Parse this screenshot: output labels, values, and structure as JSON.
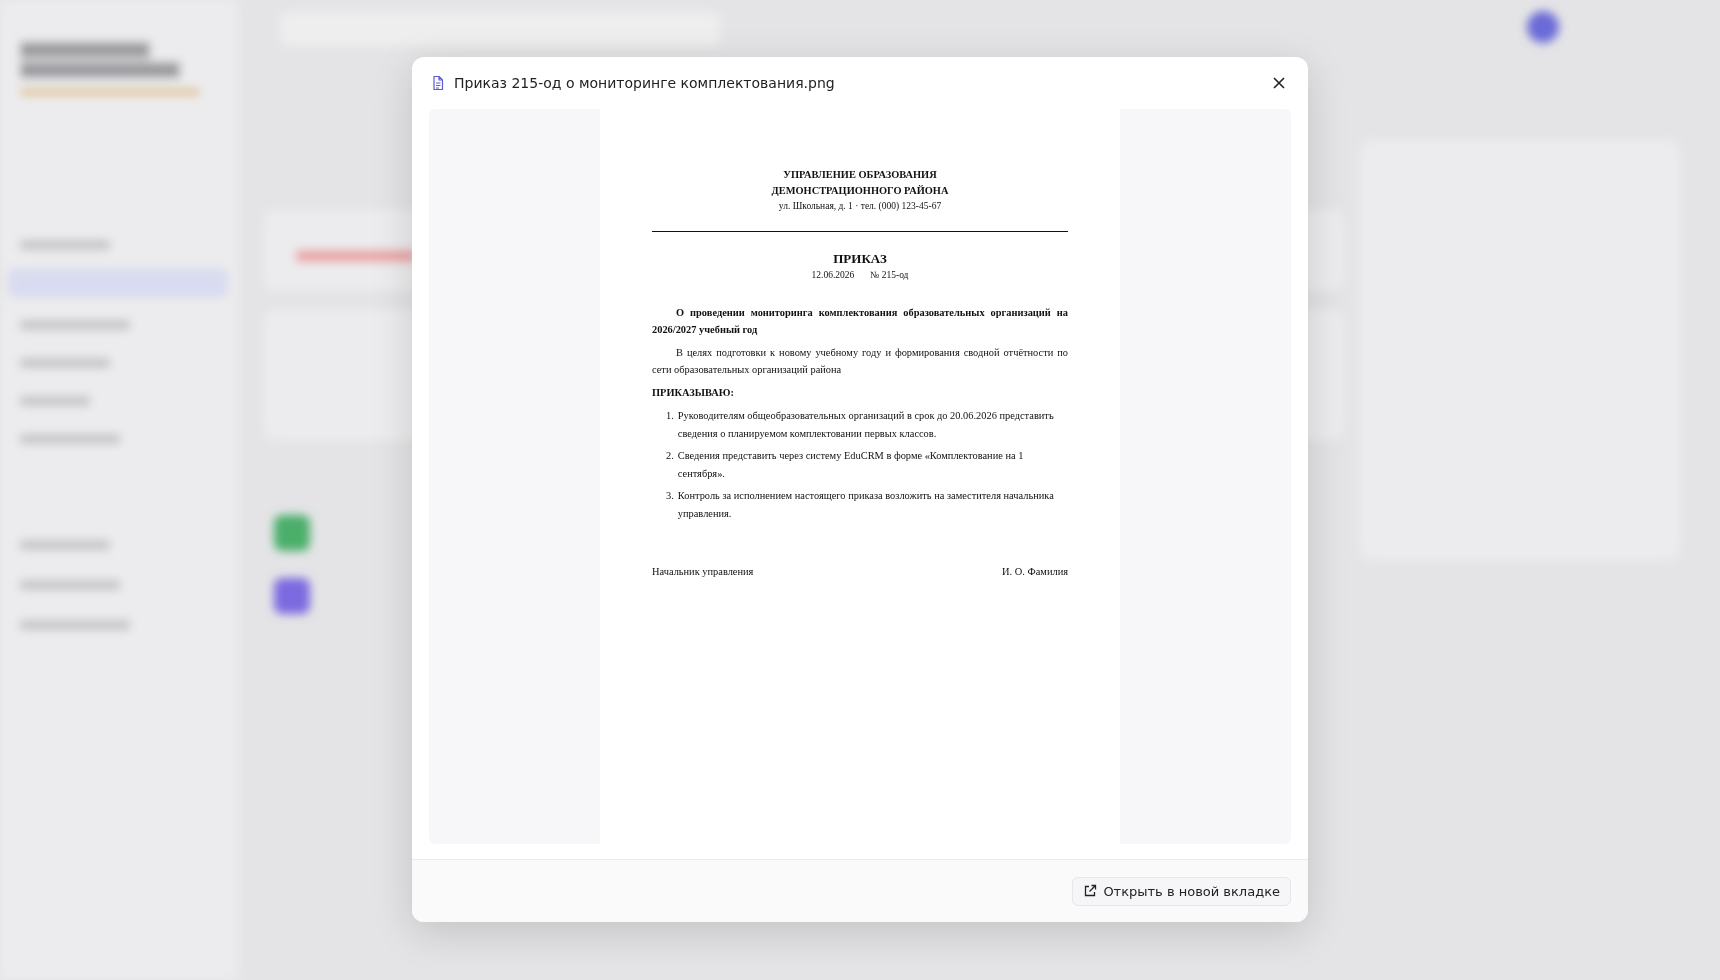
{
  "dialog": {
    "title": "Приказ 215-од о мониторинге комплектования.png",
    "document": {
      "org_lines": [
        "УПРАВЛЕНИЕ ОБРАЗОВАНИЯ",
        "ДЕМОНСТРАЦИОННОГО РАЙОНА"
      ],
      "address": "ул. Школьная, д. 1 · тел. (000) 123-45-67",
      "heading": "ПРИКАЗ",
      "date": "12.06.2026",
      "number": "№ 215-од",
      "subject": "О проведении мониторинга комплектования образовательных организаций на 2026/2027 учебный год",
      "preamble": "В целях подготовки к новому учебному году и формирования сводной отчётности по сети образовательных организаций района",
      "order_word": "ПРИКАЗЫВАЮ:",
      "items": [
        {
          "number": "1.",
          "text": "Руководителям общеобразовательных организаций в срок до 20.06.2026 представить сведения о планируемом комплектовании первых классов."
        },
        {
          "number": "2.",
          "text": "Сведения представить через систему EduCRM в форме «Комплектование на 1 сентября»."
        },
        {
          "number": "3.",
          "text": "Контроль за исполнением настоящего приказа возложить на заместителя начальника управления."
        }
      ],
      "signature": {
        "position": "Начальник управления",
        "name": "И. О. Фамилия"
      }
    },
    "open_button": "Открыть в новой вкладке"
  }
}
